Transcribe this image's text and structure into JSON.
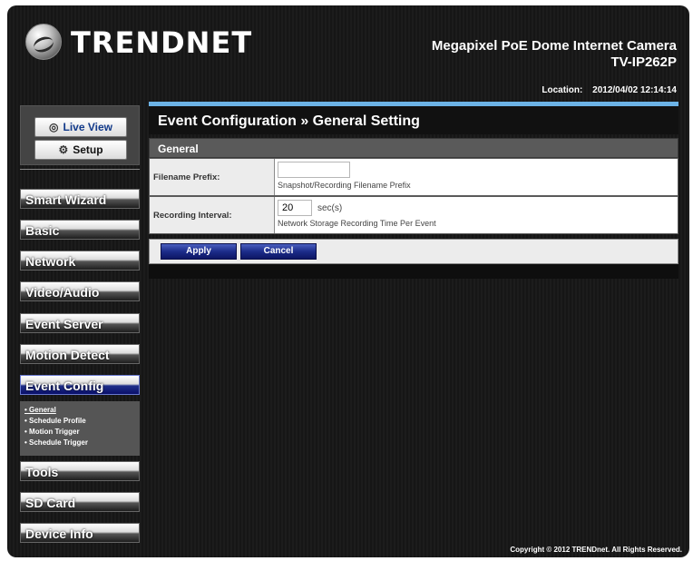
{
  "header": {
    "brand": "TRENDNET",
    "product_name": "Megapixel PoE Dome Internet Camera",
    "model": "TV-IP262P"
  },
  "status": {
    "location_label": "Location:",
    "datetime": "2012/04/02 12:14:14"
  },
  "quick_buttons": {
    "live_view": "Live View",
    "setup": "Setup"
  },
  "nav": {
    "smart_wizard": "Smart Wizard",
    "basic": "Basic",
    "network": "Network",
    "video_audio": "Video/Audio",
    "event_server": "Event Server",
    "motion_detect": "Motion Detect",
    "event_config": "Event Config",
    "tools": "Tools",
    "sd_card": "SD Card",
    "device_info": "Device Info"
  },
  "submenu": {
    "general": "• General",
    "schedule_profile": "• Schedule Profile",
    "motion_trigger": "• Motion Trigger",
    "schedule_trigger": "• Schedule Trigger"
  },
  "main": {
    "title": "Event Configuration » General Setting",
    "section": "General",
    "prefix_label": "Filename Prefix:",
    "prefix_value": "",
    "prefix_hint": "Snapshot/Recording Filename Prefix",
    "interval_label": "Recording Interval:",
    "interval_value": "20",
    "interval_unit": "sec(s)",
    "interval_hint": "Network Storage Recording Time Per Event",
    "apply": "Apply",
    "cancel": "Cancel"
  },
  "footer": {
    "copyright": "Copyright © 2012 TRENDnet. All Rights Reserved."
  },
  "colors": {
    "accent_blue": "#1c2c8a",
    "title_bar_stripe": "#6cb3e6",
    "section_bar": "#5a5a5a"
  }
}
